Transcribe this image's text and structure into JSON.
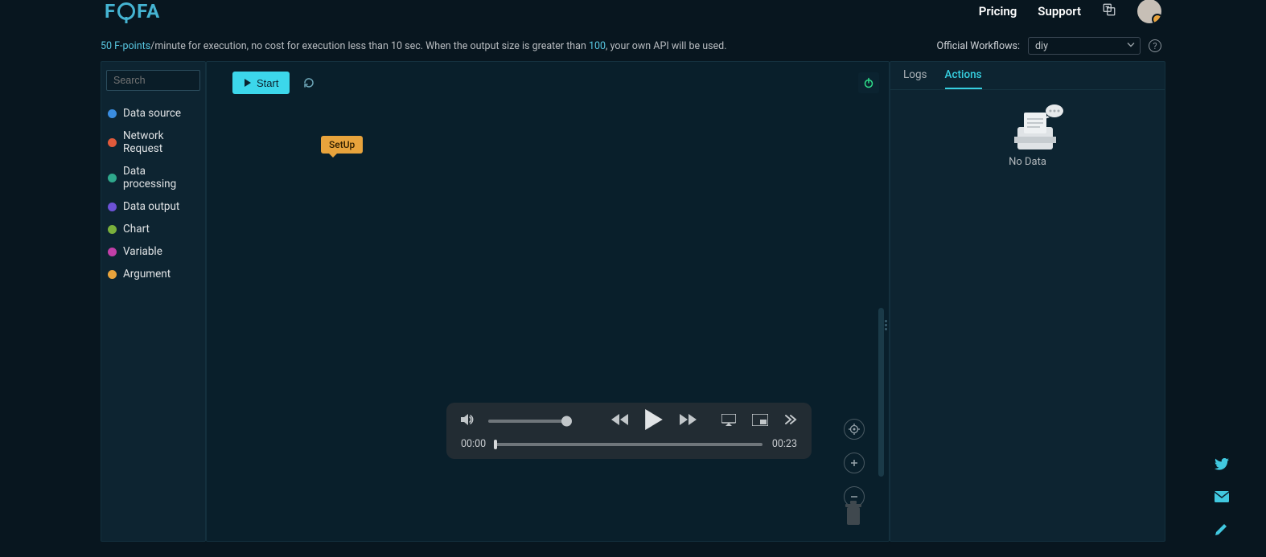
{
  "header": {
    "logo_a": "F",
    "logo_b": "FA",
    "nav": {
      "pricing": "Pricing",
      "support": "Support"
    }
  },
  "infobar": {
    "fpoints_count": "50 F-points",
    "text_mid1": "/minute for execution, no cost for execution less than 10 sec. When the output size is greater than ",
    "threshold": "100",
    "text_mid2": ", your own API will be used.",
    "workflows_label": "Official Workflows:",
    "workflow_selected": "diy"
  },
  "sidebar": {
    "search_placeholder": "Search",
    "categories": [
      {
        "label": "Data source",
        "color": "#3a8de0"
      },
      {
        "label": "Network Request",
        "color": "#e05a3b"
      },
      {
        "label": "Data processing",
        "color": "#2fa88c"
      },
      {
        "label": "Data output",
        "color": "#6d52d6"
      },
      {
        "label": "Chart",
        "color": "#7ab03c"
      },
      {
        "label": "Variable",
        "color": "#c23fa8"
      },
      {
        "label": "Argument",
        "color": "#e8a33c"
      }
    ]
  },
  "canvas": {
    "start_label": "Start",
    "node_label": "SetUp"
  },
  "video": {
    "current_time": "00:00",
    "duration": "00:23"
  },
  "panel": {
    "tab_logs": "Logs",
    "tab_actions": "Actions",
    "empty_text": "No Data"
  }
}
